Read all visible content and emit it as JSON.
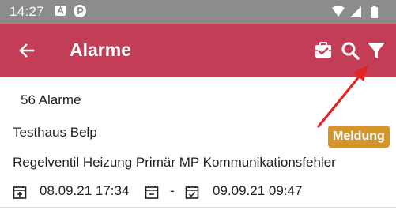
{
  "status_bar": {
    "time": "14:27",
    "icons": [
      "notification-a-icon",
      "notification-p-icon",
      "wifi-icon",
      "signal-icon",
      "battery-icon"
    ]
  },
  "app_bar": {
    "title": "Alarme",
    "back_icon": "arrow-back-icon",
    "actions": [
      "report-icon",
      "search-icon",
      "filter-icon"
    ],
    "color": "#c23d55"
  },
  "list": {
    "count_label": "56 Alarme",
    "items": [
      {
        "title": "Testhaus Belp",
        "badge": "Meldung",
        "badge_color": "#d4952b",
        "description": "Regelventil Heizung Primär MP Kommunikationsfehler",
        "date_from": "08.09.21 17:34",
        "date_separator": "-",
        "date_to": "09.09.21 09:47"
      }
    ]
  },
  "annotation": {
    "arrow_color": "#e32222",
    "points_to": "filter-icon"
  }
}
